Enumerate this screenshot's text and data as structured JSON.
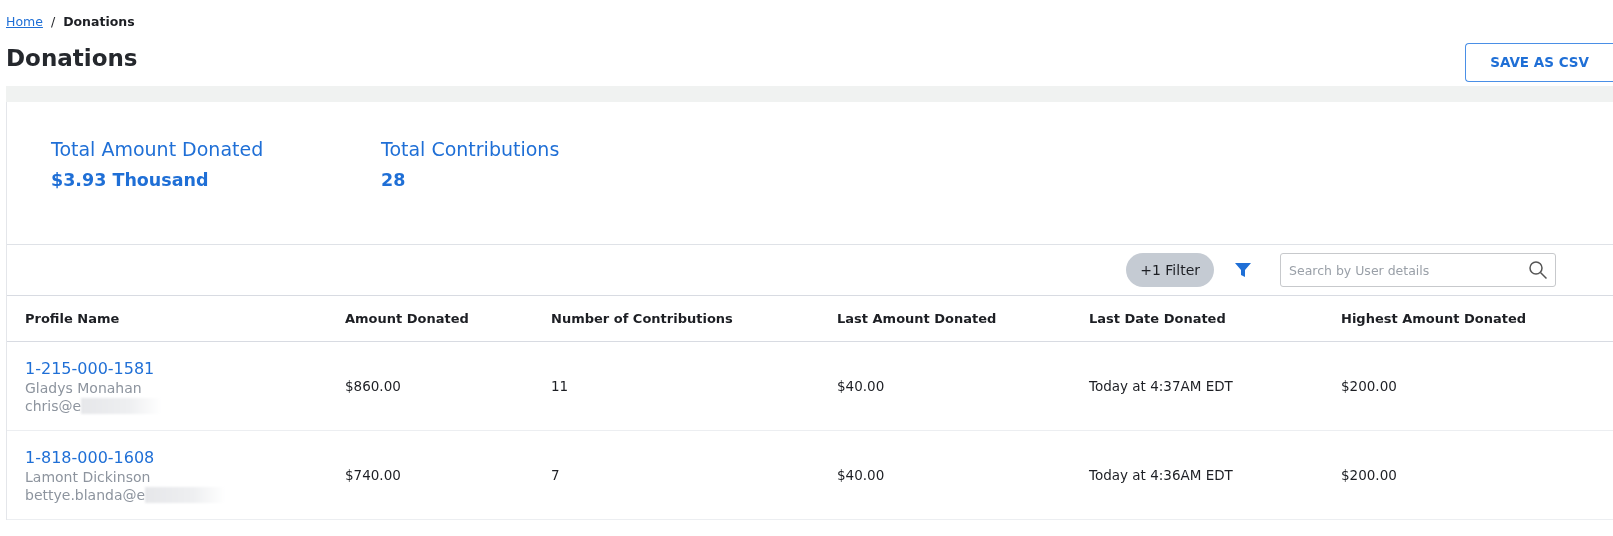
{
  "breadcrumb": {
    "items": [
      {
        "label": "Home",
        "kind": "link"
      },
      {
        "label": "Donations",
        "kind": "current"
      }
    ],
    "separator": "/"
  },
  "title": "Donations",
  "save_button": "SAVE AS CSV",
  "summary": [
    {
      "label": "Total Amount Donated",
      "value": "$3.93 Thousand"
    },
    {
      "label": "Total Contributions",
      "value": "28"
    }
  ],
  "toolbar": {
    "filter_chip": "+1 Filter",
    "search": {
      "placeholder": "Search by User details"
    }
  },
  "table": {
    "columns": [
      "Profile Name",
      "Amount Donated",
      "Number of Contributions",
      "Last Amount Donated",
      "Last Date Donated",
      "Highest Amount Donated"
    ],
    "rows": [
      {
        "cells": [
          {
            "kind": "profile",
            "phone": "1-215-000-1581",
            "name": "Gladys Monahan",
            "email": "chris@e"
          },
          {
            "kind": "text",
            "text": "$860.00"
          },
          {
            "kind": "text",
            "text": "11"
          },
          {
            "kind": "text",
            "text": "$40.00"
          },
          {
            "kind": "text",
            "text": "Today at 4:37AM EDT"
          },
          {
            "kind": "text",
            "text": "$200.00"
          }
        ]
      },
      {
        "cells": [
          {
            "kind": "profile",
            "phone": "1-818-000-1608",
            "name": "Lamont Dickinson",
            "email": "bettye.blanda@e"
          },
          {
            "kind": "text",
            "text": "$740.00"
          },
          {
            "kind": "text",
            "text": "7"
          },
          {
            "kind": "text",
            "text": "$40.00"
          },
          {
            "kind": "text",
            "text": "Today at 4:36AM EDT"
          },
          {
            "kind": "text",
            "text": "$200.00"
          }
        ]
      }
    ]
  }
}
